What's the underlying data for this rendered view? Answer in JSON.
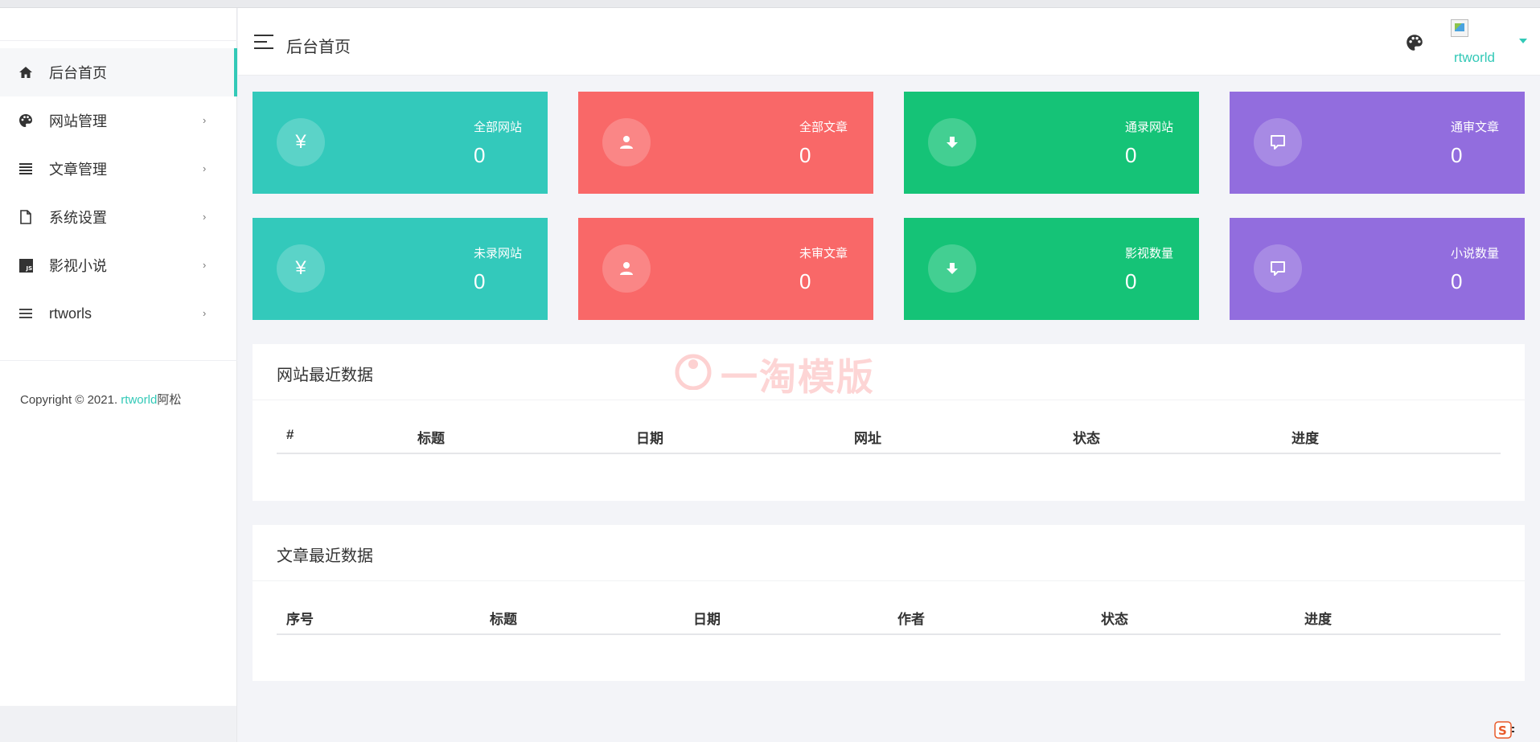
{
  "sidebar": {
    "items": [
      {
        "label": "后台首页",
        "icon": "home-icon",
        "active": true
      },
      {
        "label": "网站管理",
        "icon": "palette-icon"
      },
      {
        "label": "文章管理",
        "icon": "list-icon"
      },
      {
        "label": "系统设置",
        "icon": "file-icon"
      },
      {
        "label": "影视小说",
        "icon": "js-icon"
      },
      {
        "label": "rtworls",
        "icon": "menu-icon"
      }
    ],
    "arrow": "›",
    "copyright": {
      "prefix": "Copyright © 2021. ",
      "brand": "rtworld",
      "suffix": "阿松"
    }
  },
  "header": {
    "title": "后台首页",
    "username": "rtworld"
  },
  "cards": [
    {
      "label": "全部网站",
      "value": "0",
      "icon": "¥",
      "color": "#33c9bb"
    },
    {
      "label": "全部文章",
      "value": "0",
      "icon": "user-icon",
      "color": "#f96868"
    },
    {
      "label": "通录网站",
      "value": "0",
      "icon": "download-icon",
      "color": "#15c377"
    },
    {
      "label": "通审文章",
      "value": "0",
      "icon": "comment-icon",
      "color": "#926dde"
    },
    {
      "label": "未录网站",
      "value": "0",
      "icon": "¥",
      "color": "#33c9bb"
    },
    {
      "label": "未审文章",
      "value": "0",
      "icon": "user-icon",
      "color": "#f96868"
    },
    {
      "label": "影视数量",
      "value": "0",
      "icon": "download-icon",
      "color": "#15c377"
    },
    {
      "label": "小说数量",
      "value": "0",
      "icon": "comment-icon",
      "color": "#926dde"
    }
  ],
  "site_panel": {
    "title": "网站最近数据",
    "columns": [
      "#",
      "标题",
      "日期",
      "网址",
      "状态",
      "进度"
    ]
  },
  "article_panel": {
    "title": "文章最近数据",
    "columns": [
      "序号",
      "标题",
      "日期",
      "作者",
      "状态",
      "进度"
    ]
  },
  "watermark": "一淘模版",
  "colors": {
    "accent": "#33c9b7"
  }
}
